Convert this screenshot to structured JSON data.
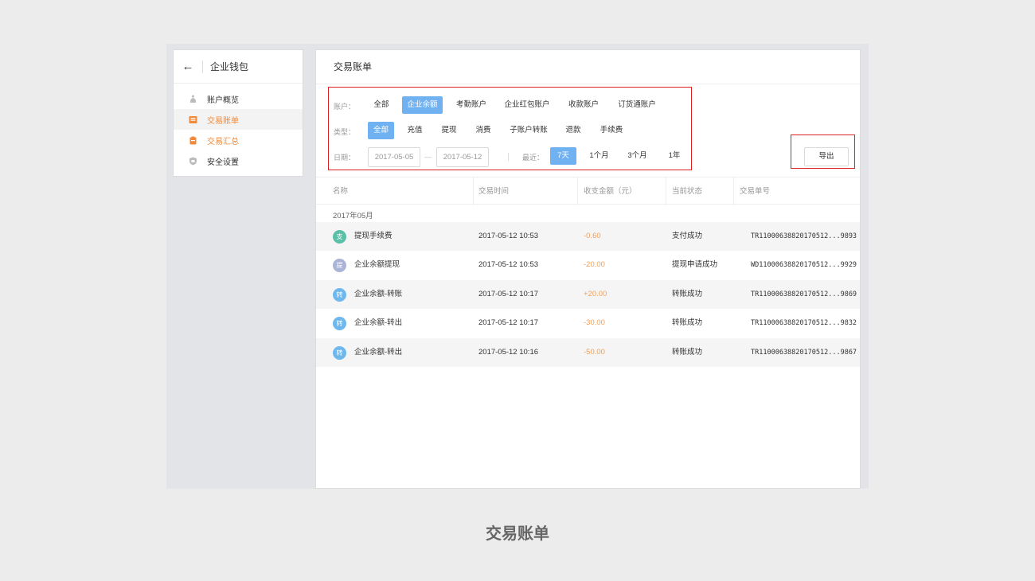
{
  "sidebar": {
    "title": "企业钱包",
    "items": [
      {
        "label": "账户概览"
      },
      {
        "label": "交易账单"
      },
      {
        "label": "交易汇总"
      },
      {
        "label": "安全设置"
      }
    ]
  },
  "main": {
    "title": "交易账单"
  },
  "filters": {
    "account_label": "账户：",
    "accounts": [
      "全部",
      "企业余额",
      "考勤账户",
      "企业红包账户",
      "收款账户",
      "订货通账户"
    ],
    "account_selected": "企业余额",
    "type_label": "类型：",
    "types": [
      "全部",
      "充值",
      "提现",
      "消费",
      "子账户转账",
      "退款",
      "手续费"
    ],
    "type_selected": "全部",
    "date_label": "日期：",
    "date_from": "2017-05-05",
    "date_to": "2017-05-12",
    "date_dash": "—",
    "recent_label": "最近：",
    "recent": [
      "7天",
      "1个月",
      "3个月",
      "1年"
    ],
    "recent_selected": "7天",
    "export_label": "导出"
  },
  "table": {
    "headers": [
      "名称",
      "交易时间",
      "收支金额（元）",
      "当前状态",
      "交易单号"
    ],
    "group_label": "2017年05月",
    "rows": [
      {
        "icon": "支",
        "icon_color": "#5bc0a8",
        "name": "提现手续费",
        "time": "2017-05-12 10:53",
        "amount": "-0.60",
        "status": "支付成功",
        "id": "TR11000638820170512...9893"
      },
      {
        "icon": "提",
        "icon_color": "#aab4d6",
        "name": "企业余额提现",
        "time": "2017-05-12 10:53",
        "amount": "-20.00",
        "status": "提现申请成功",
        "id": "WD11000638820170512...9929"
      },
      {
        "icon": "转",
        "icon_color": "#6fb8ee",
        "name": "企业余额-转账",
        "time": "2017-05-12 10:17",
        "amount": "+20.00",
        "status": "转账成功",
        "id": "TR11000638820170512...9869"
      },
      {
        "icon": "转",
        "icon_color": "#6fb8ee",
        "name": "企业余额-转出",
        "time": "2017-05-12 10:17",
        "amount": "-30.00",
        "status": "转账成功",
        "id": "TR11000638820170512...9832"
      },
      {
        "icon": "转",
        "icon_color": "#6fb8ee",
        "name": "企业余额-转出",
        "time": "2017-05-12 10:16",
        "amount": "-50.00",
        "status": "转账成功",
        "id": "TR11000638820170512...9867"
      }
    ]
  },
  "caption": "交易账单",
  "colors": {
    "accent": "#6fb1f1",
    "orange": "#f08a3a",
    "amount": "#f0a05a",
    "highlight": "#e02020"
  }
}
